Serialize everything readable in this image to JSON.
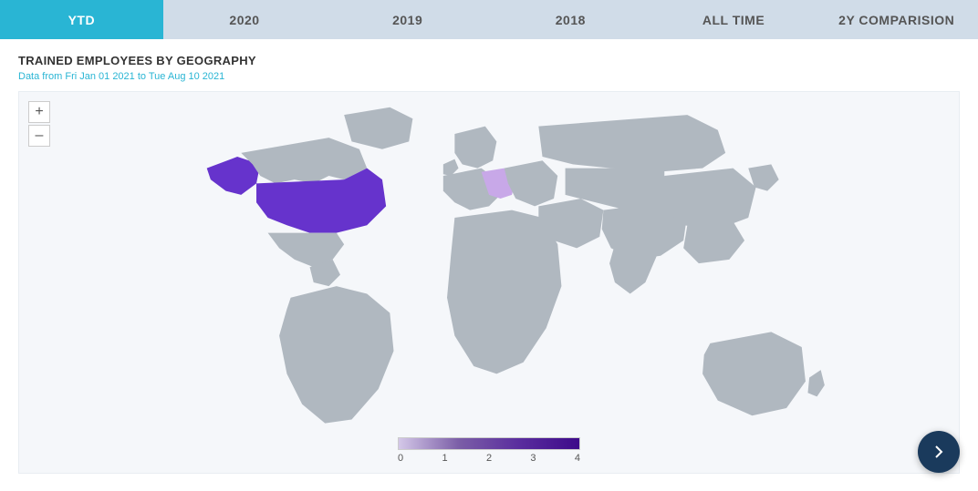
{
  "tabs": [
    {
      "id": "ytd",
      "label": "YTD",
      "active": true
    },
    {
      "id": "2020",
      "label": "2020",
      "active": false
    },
    {
      "id": "2019",
      "label": "2019",
      "active": false
    },
    {
      "id": "2018",
      "label": "2018",
      "active": false
    },
    {
      "id": "alltime",
      "label": "ALL TIME",
      "active": false
    },
    {
      "id": "2ycomp",
      "label": "2Y COMPARISION",
      "active": false
    }
  ],
  "chart": {
    "title": "TRAINED EMPLOYEES BY GEOGRAPHY",
    "subtitle": "Data from Fri Jan 01 2021 to Tue Aug 10 2021"
  },
  "zoom": {
    "plus_label": "+",
    "minus_label": "–"
  },
  "legend": {
    "labels": [
      "0",
      "1",
      "2",
      "3",
      "4"
    ]
  },
  "colors": {
    "active_tab": "#29b5d4",
    "tab_bar_bg": "#d0dce8",
    "map_default": "#b0b8c0",
    "map_highlight_light": "#c8a8e8",
    "map_highlight_mid": "#7b5ea7",
    "map_highlight_dark": "#5a2d9e",
    "map_highlight_usa": "#6633cc",
    "subtitle_color": "#29b5d4"
  }
}
